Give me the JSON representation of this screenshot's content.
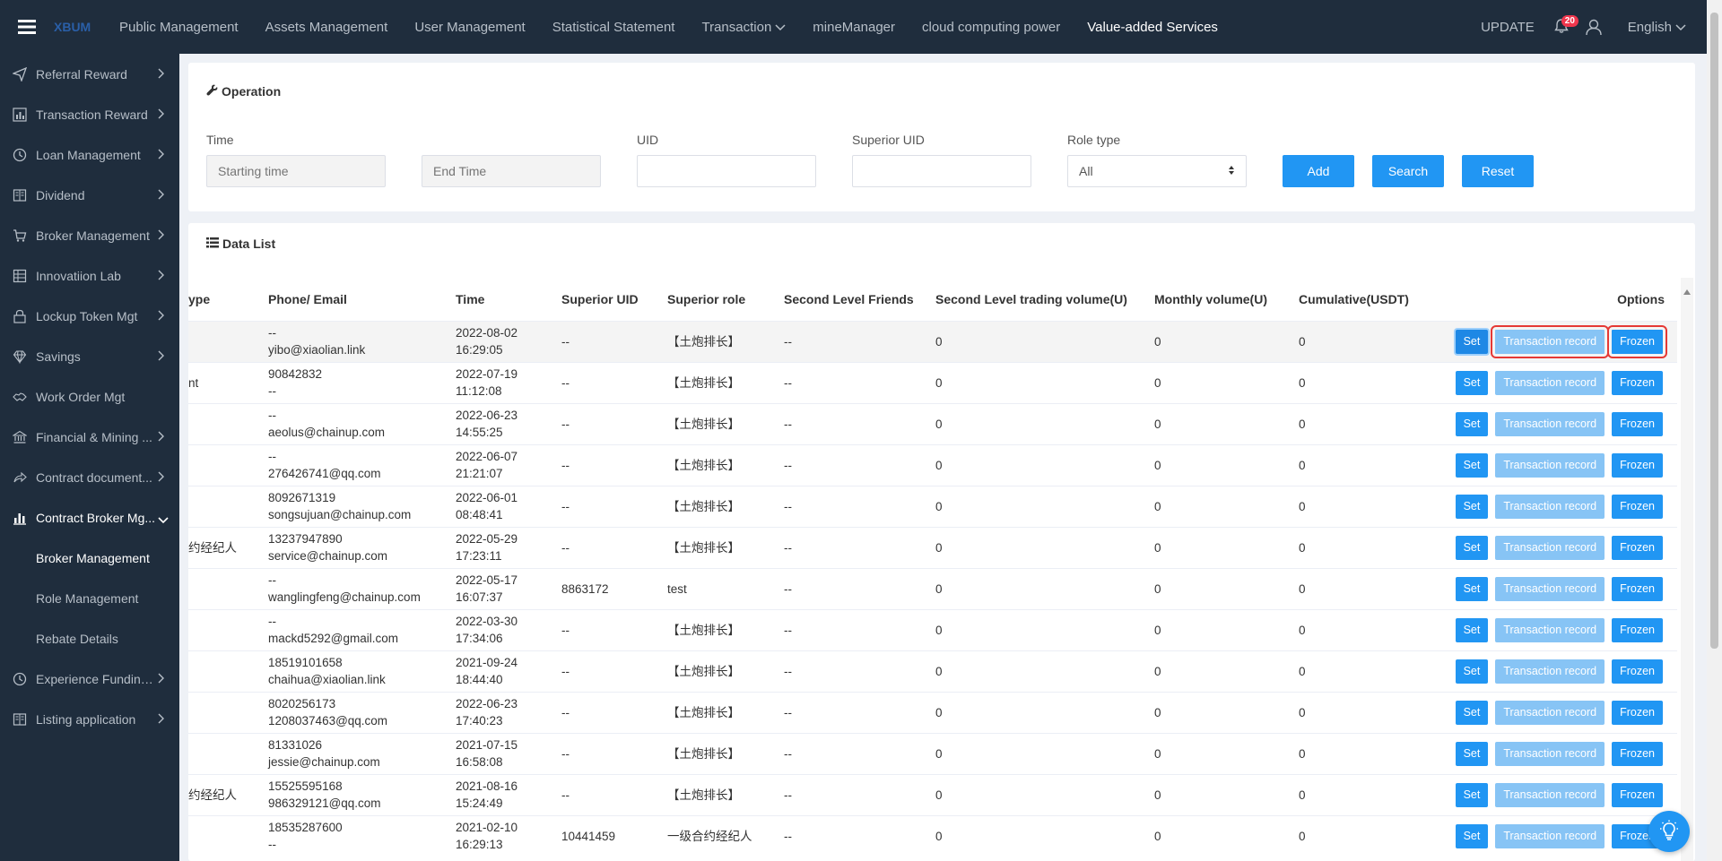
{
  "header": {
    "logo": "XBUM",
    "nav": [
      {
        "label": "Public Management"
      },
      {
        "label": "Assets Management"
      },
      {
        "label": "User Management"
      },
      {
        "label": "Statistical Statement"
      },
      {
        "label": "Transaction"
      },
      {
        "label": "mineManager"
      },
      {
        "label": "cloud computing power"
      },
      {
        "label": "Value-added Services"
      }
    ],
    "update": "UPDATE",
    "notification_count": "20",
    "language": "English"
  },
  "sidebar": {
    "items": [
      {
        "label": "Referral Reward",
        "icon": "send-icon"
      },
      {
        "label": "Transaction Reward",
        "icon": "bar-chart-icon"
      },
      {
        "label": "Loan Management",
        "icon": "clock-icon"
      },
      {
        "label": "Dividend",
        "icon": "book-icon"
      },
      {
        "label": "Broker Management",
        "icon": "cart-icon"
      },
      {
        "label": "Innovatiion Lab",
        "icon": "grid-icon"
      },
      {
        "label": "Lockup Token Mgt",
        "icon": "lock-icon"
      },
      {
        "label": "Savings",
        "icon": "diamond-icon"
      },
      {
        "label": "Work Order Mgt",
        "icon": "handshake-icon"
      },
      {
        "label": "Financial & Mining ...",
        "icon": "bank-icon"
      },
      {
        "label": "Contract document...",
        "icon": "share-icon"
      },
      {
        "label": "Contract Broker Mg...",
        "icon": "bar-chart-icon"
      }
    ],
    "sub_items": [
      {
        "label": "Broker Management"
      },
      {
        "label": "Role Management"
      },
      {
        "label": "Rebate Details"
      }
    ],
    "bottom_items": [
      {
        "label": "Experience Funding...",
        "icon": "clock-icon"
      },
      {
        "label": "Listing application",
        "icon": "book-icon"
      }
    ]
  },
  "operation": {
    "title": "Operation",
    "time_label": "Time",
    "start_placeholder": "Starting time",
    "end_placeholder": "End Time",
    "uid_label": "UID",
    "superior_uid_label": "Superior UID",
    "role_type_label": "Role type",
    "role_type_value": "All",
    "add": "Add",
    "search": "Search",
    "reset": "Reset"
  },
  "list": {
    "title": "Data List",
    "columns": [
      "ype",
      "Phone/ Email",
      "Time",
      "Superior UID",
      "Superior role",
      "Second Level Friends",
      "Second Level trading volume(U)",
      "Monthly volume(U)",
      "Cumulative(USDT)",
      "Options"
    ],
    "btn_set": "Set",
    "btn_record": "Transaction record",
    "btn_frozen": "Frozen",
    "rows": [
      {
        "type": "",
        "phone": "--",
        "email": "yibo@xiaolian.link",
        "date": "2022-08-02",
        "clock": "16:29:05",
        "sup_uid": "--",
        "sup_role": "【土炮排长】",
        "friends": "--",
        "vol2": "0",
        "monthly": "0",
        "cum": "0"
      },
      {
        "type": "nt",
        "phone": "90842832",
        "email": "--",
        "date": "2022-07-19",
        "clock": "11:12:08",
        "sup_uid": "--",
        "sup_role": "【土炮排长】",
        "friends": "--",
        "vol2": "0",
        "monthly": "0",
        "cum": "0"
      },
      {
        "type": "",
        "phone": "--",
        "email": "aeolus@chainup.com",
        "date": "2022-06-23",
        "clock": "14:55:25",
        "sup_uid": "--",
        "sup_role": "【土炮排长】",
        "friends": "--",
        "vol2": "0",
        "monthly": "0",
        "cum": "0"
      },
      {
        "type": "",
        "phone": "--",
        "email": "276426741@qq.com",
        "date": "2022-06-07",
        "clock": "21:21:07",
        "sup_uid": "--",
        "sup_role": "【土炮排长】",
        "friends": "--",
        "vol2": "0",
        "monthly": "0",
        "cum": "0"
      },
      {
        "type": "",
        "phone": "8092671319",
        "email": "songsujuan@chainup.com",
        "date": "2022-06-01",
        "clock": "08:48:41",
        "sup_uid": "--",
        "sup_role": "【土炮排长】",
        "friends": "--",
        "vol2": "0",
        "monthly": "0",
        "cum": "0"
      },
      {
        "type": "约经纪人",
        "phone": "13237947890",
        "email": "service@chainup.com",
        "date": "2022-05-29",
        "clock": "17:23:11",
        "sup_uid": "--",
        "sup_role": "【土炮排长】",
        "friends": "--",
        "vol2": "0",
        "monthly": "0",
        "cum": "0"
      },
      {
        "type": "",
        "phone": "--",
        "email": "wanglingfeng@chainup.com",
        "date": "2022-05-17",
        "clock": "16:07:37",
        "sup_uid": "8863172",
        "sup_role": "test",
        "friends": "--",
        "vol2": "0",
        "monthly": "0",
        "cum": "0"
      },
      {
        "type": "",
        "phone": "--",
        "email": "mackd5292@gmail.com",
        "date": "2022-03-30",
        "clock": "17:34:06",
        "sup_uid": "--",
        "sup_role": "【土炮排长】",
        "friends": "--",
        "vol2": "0",
        "monthly": "0",
        "cum": "0"
      },
      {
        "type": "",
        "phone": "18519101658",
        "email": "chaihua@xiaolian.link",
        "date": "2021-09-24",
        "clock": "18:44:40",
        "sup_uid": "--",
        "sup_role": "【土炮排长】",
        "friends": "--",
        "vol2": "0",
        "monthly": "0",
        "cum": "0"
      },
      {
        "type": "",
        "phone": "8020256173",
        "email": "1208037463@qq.com",
        "date": "2022-06-23",
        "clock": "17:40:23",
        "sup_uid": "--",
        "sup_role": "【土炮排长】",
        "friends": "--",
        "vol2": "0",
        "monthly": "0",
        "cum": "0"
      },
      {
        "type": "",
        "phone": "81331026",
        "email": "jessie@chainup.com",
        "date": "2021-07-15",
        "clock": "16:58:08",
        "sup_uid": "--",
        "sup_role": "【土炮排长】",
        "friends": "--",
        "vol2": "0",
        "monthly": "0",
        "cum": "0"
      },
      {
        "type": "约经纪人",
        "phone": "15525595168",
        "email": "986329121@qq.com",
        "date": "2021-08-16",
        "clock": "15:24:49",
        "sup_uid": "--",
        "sup_role": "【土炮排长】",
        "friends": "--",
        "vol2": "0",
        "monthly": "0",
        "cum": "0"
      },
      {
        "type": "",
        "phone": "18535287600",
        "email": "--",
        "date": "2021-02-10",
        "clock": "16:29:13",
        "sup_uid": "10441459",
        "sup_role": "一级合约经纪人",
        "friends": "--",
        "vol2": "0",
        "monthly": "0",
        "cum": "0"
      }
    ]
  },
  "colors": {
    "sidebar_bg": "#1f2d3d",
    "primary": "#2196f3",
    "record_btn": "#87c4f5",
    "highlight_box": "#e53935",
    "badge": "#f0364d"
  }
}
